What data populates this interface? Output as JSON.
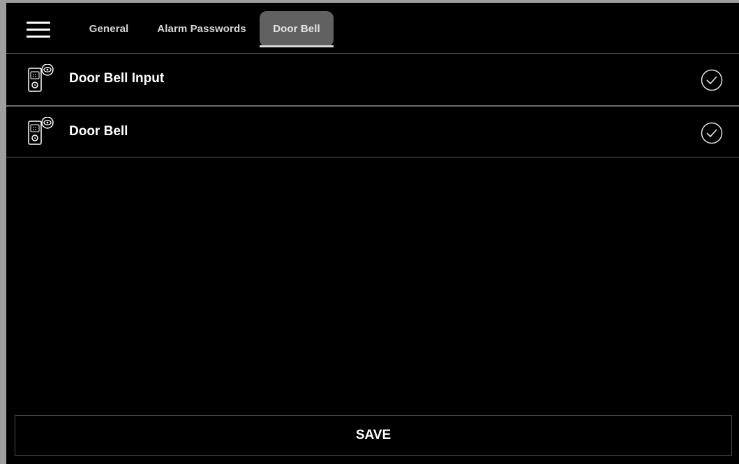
{
  "header": {
    "menu_icon": "hamburger-menu-icon",
    "tabs": [
      {
        "label": "General",
        "active": false
      },
      {
        "label": "Alarm Passwords",
        "active": false
      },
      {
        "label": "Door Bell",
        "active": true
      }
    ]
  },
  "list": {
    "items": [
      {
        "label": "Door Bell Input",
        "icon": "doorbell-icon",
        "status_icon": "check-circle-icon",
        "checked": true
      },
      {
        "label": "Door Bell",
        "icon": "doorbell-icon",
        "status_icon": "check-circle-icon",
        "checked": true
      }
    ]
  },
  "footer": {
    "save_label": "SAVE"
  },
  "colors": {
    "background": "#000000",
    "active_tab": "#616161",
    "text": "#ffffff",
    "divider": "#5a5a5a"
  }
}
